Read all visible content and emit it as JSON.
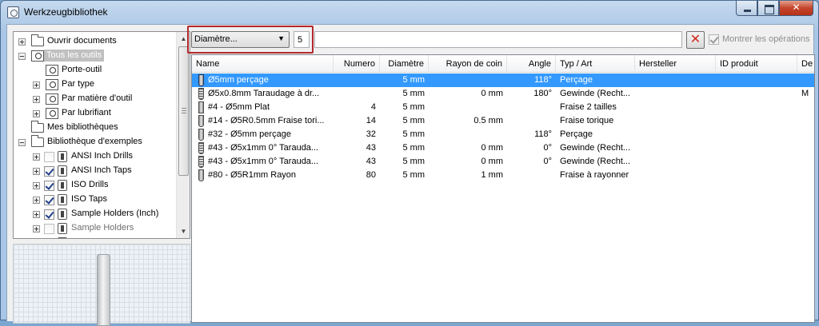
{
  "window": {
    "title": "Werkzeugbibliothek"
  },
  "tree": {
    "items": [
      {
        "label": "Ouvrir documents"
      },
      {
        "label": "Tous les outils"
      },
      {
        "label": "Porte-outil"
      },
      {
        "label": "Par type"
      },
      {
        "label": "Par matière d'outil"
      },
      {
        "label": "Par lubrifiant"
      },
      {
        "label": "Mes bibliothèques"
      },
      {
        "label": "Bibliothèque d'exemples"
      },
      {
        "label": "ANSI Inch Drills"
      },
      {
        "label": "ANSI Inch Taps"
      },
      {
        "label": "ISO Drills"
      },
      {
        "label": "ISO Taps"
      },
      {
        "label": "Sample Holders (Inch)"
      },
      {
        "label": "Sample Holders"
      }
    ]
  },
  "filter": {
    "field": "Diamètre...",
    "value": "5",
    "search_value": "",
    "show_operations_label": "Montrer les opérations"
  },
  "grid": {
    "columns": [
      "Name",
      "Numero",
      "Diamètre",
      "Rayon de coin",
      "Angle",
      "Typ / Art",
      "Hersteller",
      "ID produit",
      "De"
    ],
    "rows": [
      {
        "icon": "drill-icon",
        "name": "Ø5mm perçage",
        "numero": "",
        "diametre": "5 mm",
        "rayon": "",
        "angle": "118°",
        "type": "Perçage",
        "hersteller": "",
        "id": "",
        "desc": ""
      },
      {
        "icon": "tap-icon",
        "name": "Ø5x0.8mm Taraudage à dr...",
        "numero": "",
        "diametre": "5 mm",
        "rayon": "0 mm",
        "angle": "180°",
        "type": "Gewinde (Recht...",
        "hersteller": "",
        "id": "",
        "desc": "M"
      },
      {
        "icon": "flat-mill-icon",
        "name": "#4 - Ø5mm Plat",
        "numero": "4",
        "diametre": "5 mm",
        "rayon": "",
        "angle": "",
        "type": "Fraise 2 tailles",
        "hersteller": "",
        "id": "",
        "desc": ""
      },
      {
        "icon": "bull-nose-mill-icon",
        "name": "#14 - Ø5R0.5mm Fraise tori...",
        "numero": "14",
        "diametre": "5 mm",
        "rayon": "0.5 mm",
        "angle": "",
        "type": "Fraise torique",
        "hersteller": "",
        "id": "",
        "desc": ""
      },
      {
        "icon": "drill-icon",
        "name": "#32 - Ø5mm perçage",
        "numero": "32",
        "diametre": "5 mm",
        "rayon": "",
        "angle": "118°",
        "type": "Perçage",
        "hersteller": "",
        "id": "",
        "desc": ""
      },
      {
        "icon": "tap-icon",
        "name": "#43 - Ø5x1mm 0° Tarauda...",
        "numero": "43",
        "diametre": "5 mm",
        "rayon": "0 mm",
        "angle": "0°",
        "type": "Gewinde (Recht...",
        "hersteller": "",
        "id": "",
        "desc": ""
      },
      {
        "icon": "tap-icon",
        "name": "#43 - Ø5x1mm 0° Tarauda...",
        "numero": "43",
        "diametre": "5 mm",
        "rayon": "0 mm",
        "angle": "0°",
        "type": "Gewinde (Recht...",
        "hersteller": "",
        "id": "",
        "desc": ""
      },
      {
        "icon": "radius-mill-icon",
        "name": "#80 - Ø5R1mm Rayon",
        "numero": "80",
        "diametre": "5 mm",
        "rayon": "1 mm",
        "angle": "",
        "type": "Fraise à rayonner",
        "hersteller": "",
        "id": "",
        "desc": ""
      }
    ]
  }
}
